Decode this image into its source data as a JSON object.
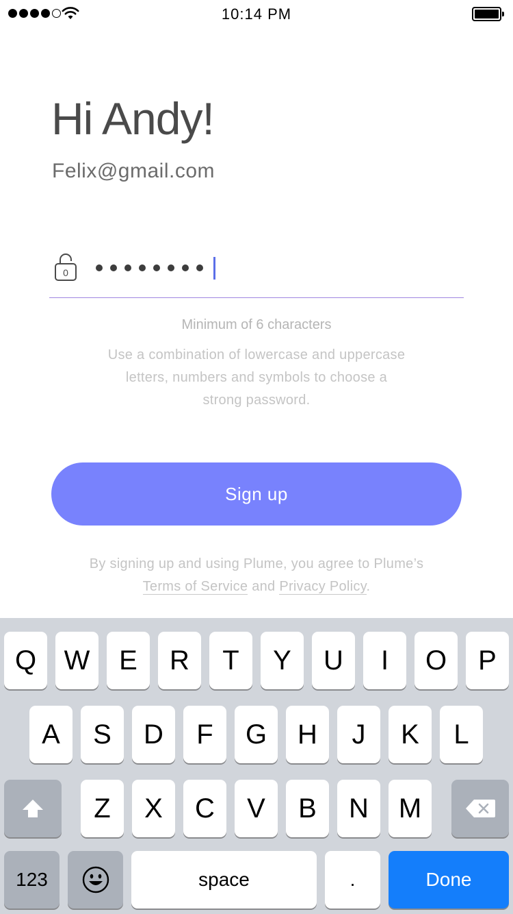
{
  "status_bar": {
    "time": "10:14 PM",
    "signal_icon": "signal-dots-icon",
    "wifi_icon": "wifi-icon",
    "battery_icon": "battery-icon"
  },
  "greeting": "Hi Andy!",
  "email": "Felix@gmail.com",
  "password": {
    "icon": "lock-icon",
    "lock_digit": "0",
    "masked_length": 8
  },
  "hint": {
    "title": "Minimum of 6 characters",
    "line1": "Use a combination of lowercase and uppercase",
    "line2": "letters, numbers and symbols to choose a",
    "line3": "strong password."
  },
  "signup_button": "Sign up",
  "legal": {
    "line1": "By signing up and using Plume, you agree to Plume’s",
    "terms": "Terms of Service",
    "and": " and ",
    "privacy_word1": "Privacy",
    "privacy_word2": "Policy",
    "period": "."
  },
  "keyboard": {
    "row1": [
      "Q",
      "W",
      "E",
      "R",
      "T",
      "Y",
      "U",
      "I",
      "O",
      "P"
    ],
    "row2": [
      "A",
      "S",
      "D",
      "F",
      "G",
      "H",
      "J",
      "K",
      "L"
    ],
    "row3": [
      "Z",
      "X",
      "C",
      "V",
      "B",
      "N",
      "M"
    ],
    "shift_icon": "shift-icon",
    "delete_icon": "delete-icon",
    "numbers_label": "123",
    "emoji_icon": "emoji-icon",
    "space_label": "space",
    "period_label": ".",
    "done_label": "Done"
  },
  "colors": {
    "accent": "#7882fd",
    "done_blue": "#147efb",
    "keyboard_bg": "#d1d5db"
  }
}
